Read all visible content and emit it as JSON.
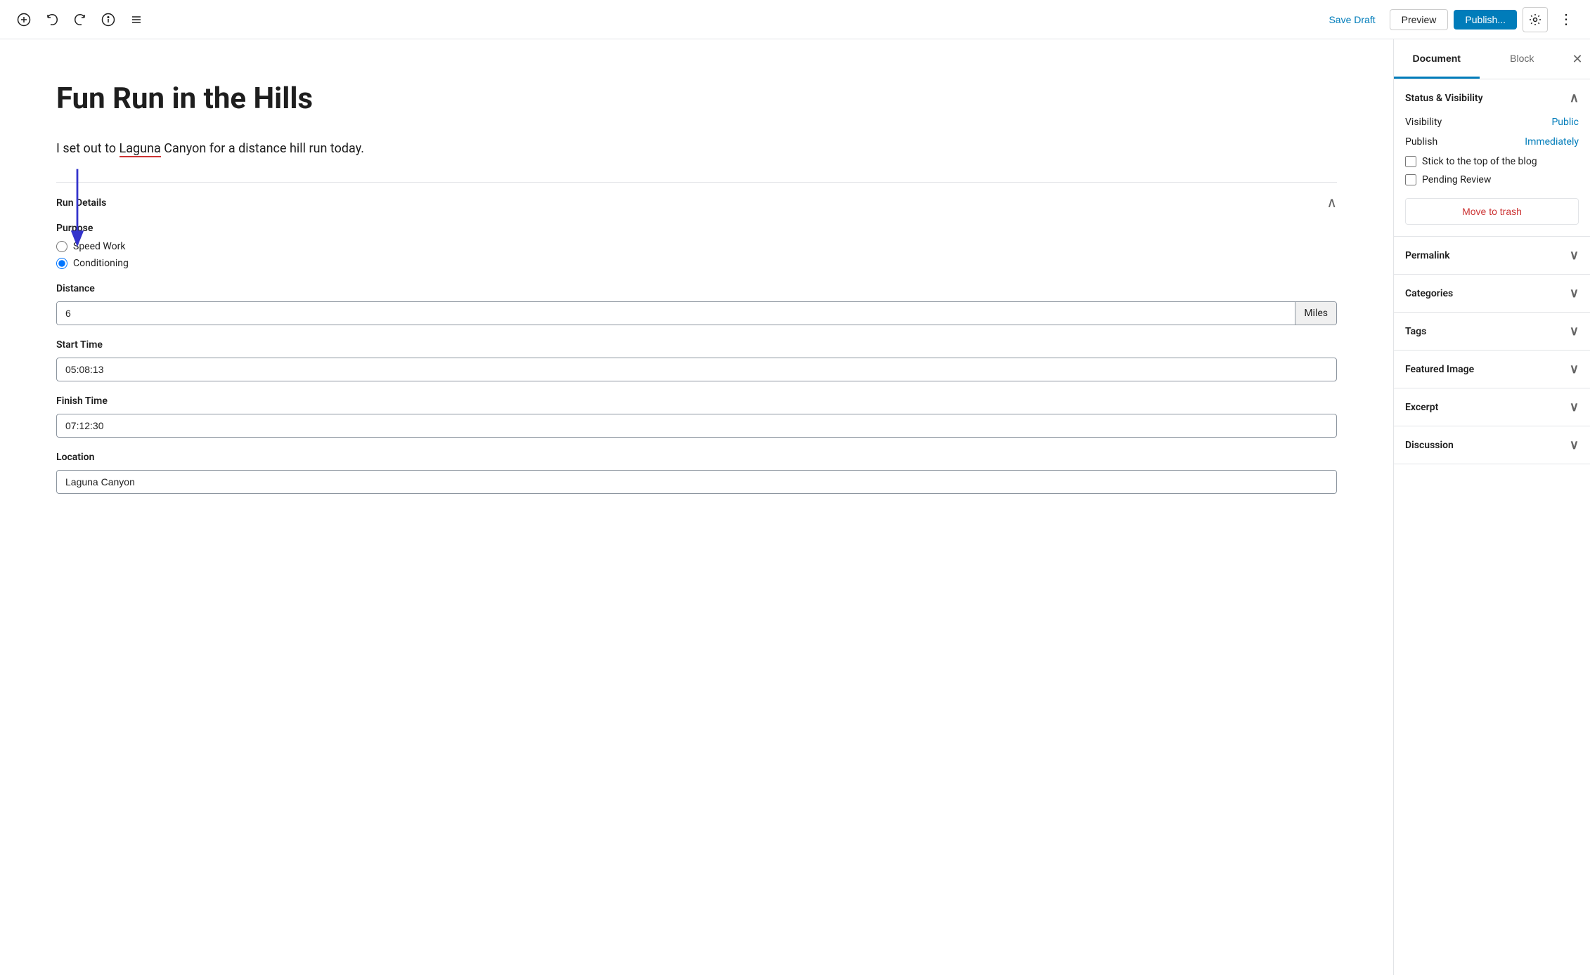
{
  "toolbar": {
    "save_draft_label": "Save Draft",
    "preview_label": "Preview",
    "publish_label": "Publish...",
    "more_label": "⋮"
  },
  "editor": {
    "post_title": "Fun Run in the Hills",
    "post_content": "I set out to Laguna Canyon for a distance hill run today.",
    "laguna_link_text": "Laguna"
  },
  "meta_box": {
    "title": "Run Details",
    "fields": {
      "purpose": {
        "label": "Purpose",
        "options": [
          {
            "value": "speed_work",
            "label": "Speed Work",
            "checked": false
          },
          {
            "value": "conditioning",
            "label": "Conditioning",
            "checked": true
          }
        ]
      },
      "distance": {
        "label": "Distance",
        "value": "6",
        "suffix": "Miles"
      },
      "start_time": {
        "label": "Start Time",
        "value": "05:08:13"
      },
      "finish_time": {
        "label": "Finish Time",
        "value": "07:12:30"
      },
      "location": {
        "label": "Location",
        "value": "Laguna Canyon"
      }
    }
  },
  "sidebar": {
    "tabs": [
      {
        "id": "document",
        "label": "Document",
        "active": true
      },
      {
        "id": "block",
        "label": "Block",
        "active": false
      }
    ],
    "sections": {
      "status_visibility": {
        "title": "Status & Visibility",
        "expanded": true,
        "visibility_label": "Visibility",
        "visibility_value": "Public",
        "publish_label": "Publish",
        "publish_value": "Immediately",
        "stick_to_top_label": "Stick to the top of the blog",
        "pending_review_label": "Pending Review",
        "move_to_trash_label": "Move to trash"
      },
      "permalink": {
        "title": "Permalink",
        "expanded": false
      },
      "categories": {
        "title": "Categories",
        "expanded": false
      },
      "tags": {
        "title": "Tags",
        "expanded": false
      },
      "featured_image": {
        "title": "Featured Image",
        "expanded": false
      },
      "excerpt": {
        "title": "Excerpt",
        "expanded": false
      },
      "discussion": {
        "title": "Discussion",
        "expanded": false
      }
    }
  }
}
